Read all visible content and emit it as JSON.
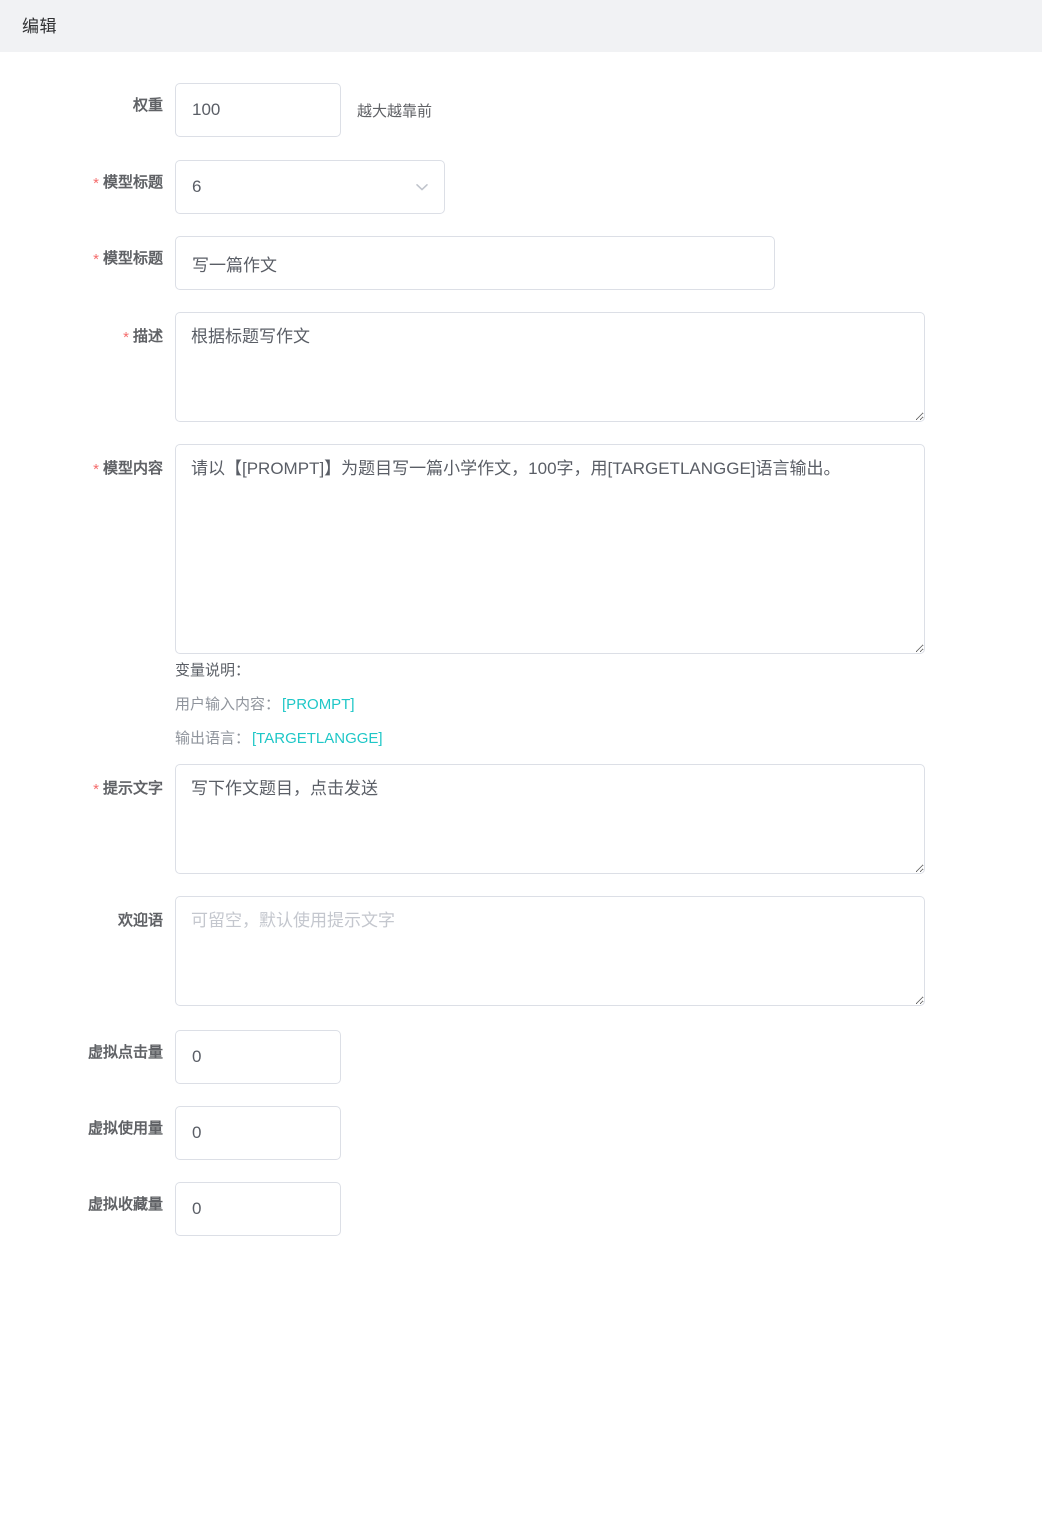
{
  "dialog": {
    "title": "编辑"
  },
  "form": {
    "weight": {
      "label": "权重",
      "required": false,
      "value": "100",
      "hint": "越大越靠前"
    },
    "model_category": {
      "label": "模型标题",
      "required": true,
      "required_mark": "*",
      "value": "6",
      "caret_icon": "chevron-down-icon",
      "options": [
        "6"
      ]
    },
    "model_title": {
      "label": "模型标题",
      "required": true,
      "required_mark": "*",
      "value": "写一篇作文",
      "placeholder": ""
    },
    "description": {
      "label": "描述",
      "required": true,
      "required_mark": "*",
      "value": "根据标题写作文",
      "placeholder": ""
    },
    "model_content": {
      "label": "模型内容",
      "required": true,
      "required_mark": "*",
      "value": "请以【[PROMPT]】为题目写一篇小学作文，100字，用[TARGETLANGGE]语言输出。",
      "placeholder": ""
    },
    "variables": {
      "heading": "变量说明：",
      "items": [
        {
          "label": "用户输入内容：",
          "token": "[PROMPT]"
        },
        {
          "label": "输出语言：",
          "token": "[TARGETLANGGE]"
        }
      ],
      "token_color": "#1fc7c7"
    },
    "prompt_text": {
      "label": "提示文字",
      "required": true,
      "required_mark": "*",
      "value": "写下作文题目，点击发送",
      "placeholder": ""
    },
    "welcome_text": {
      "label": "欢迎语",
      "required": false,
      "value": "",
      "placeholder": "可留空，默认使用提示文字"
    },
    "virtual_clicks": {
      "label": "虚拟点击量",
      "required": false,
      "value": "0"
    },
    "virtual_usage": {
      "label": "虚拟使用量",
      "required": false,
      "value": "0"
    },
    "virtual_favorites": {
      "label": "虚拟收藏量",
      "required": false,
      "value": "0"
    }
  },
  "colors": {
    "header_background": "#f1f2f4",
    "required_asterisk": "#f56c6c",
    "border": "#dcdfe6",
    "label_text": "#606266",
    "token_teal": "#1fc7c7"
  }
}
